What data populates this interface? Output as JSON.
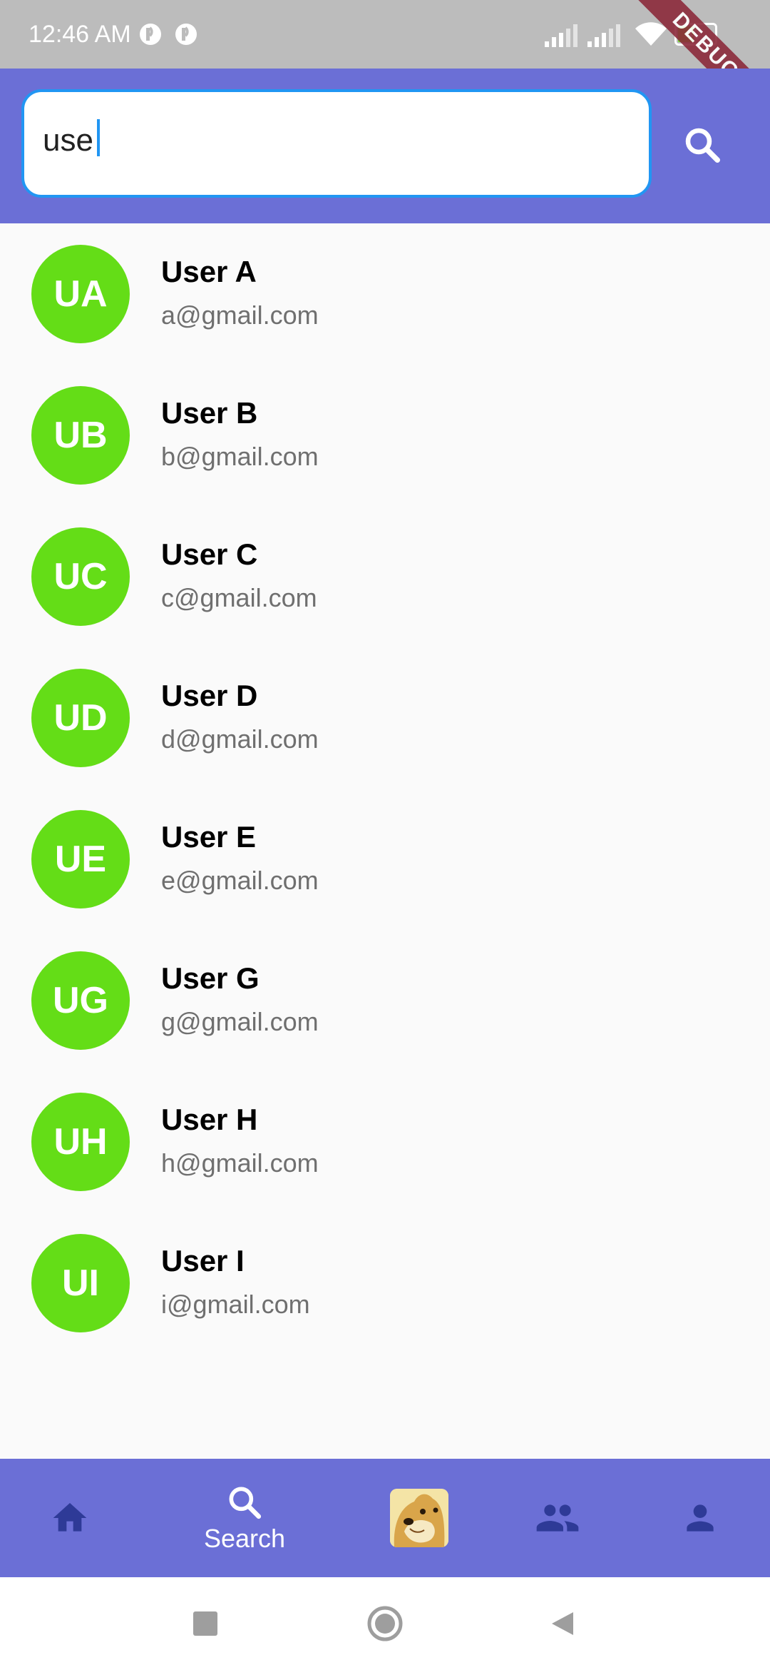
{
  "status_bar": {
    "time": "12:46 AM",
    "battery": "40",
    "debug_label": "DEBUG"
  },
  "search": {
    "value": "use",
    "button_icon": "search-icon"
  },
  "users": [
    {
      "initials": "UA",
      "name": "User A",
      "email": "a@gmail.com"
    },
    {
      "initials": "UB",
      "name": "User B",
      "email": "b@gmail.com"
    },
    {
      "initials": "UC",
      "name": "User C",
      "email": "c@gmail.com"
    },
    {
      "initials": "UD",
      "name": "User D",
      "email": "d@gmail.com"
    },
    {
      "initials": "UE",
      "name": "User E",
      "email": "e@gmail.com"
    },
    {
      "initials": "UG",
      "name": "User G",
      "email": "g@gmail.com"
    },
    {
      "initials": "UH",
      "name": "User H",
      "email": "h@gmail.com"
    },
    {
      "initials": "UI",
      "name": "User I",
      "email": "i@gmail.com"
    }
  ],
  "bottom_nav": {
    "items": [
      {
        "icon": "home-icon",
        "label": ""
      },
      {
        "icon": "search-icon",
        "label": "Search"
      },
      {
        "icon": "doge-avatar",
        "label": ""
      },
      {
        "icon": "group-icon",
        "label": ""
      },
      {
        "icon": "person-icon",
        "label": ""
      }
    ]
  },
  "colors": {
    "app_bar": "#6b6fd6",
    "avatar": "#64dd17",
    "focus_border": "#2196f3",
    "nav_icon_inactive": "#2e3a97"
  }
}
